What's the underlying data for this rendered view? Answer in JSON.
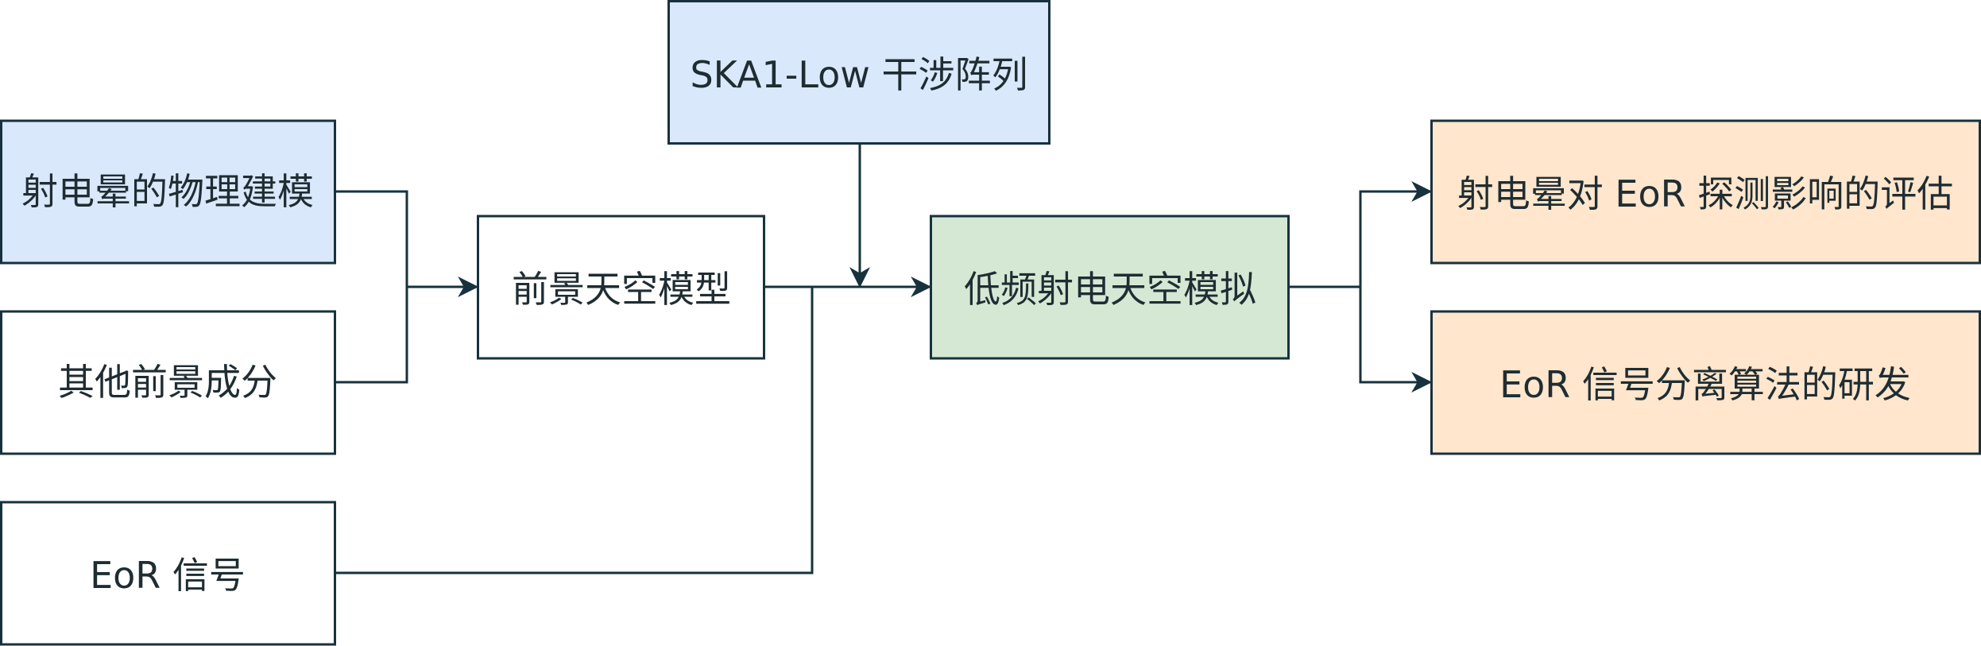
{
  "colors": {
    "blue_fill": "#dae8fc",
    "green_fill": "#d5e8d4",
    "orange_fill": "#ffe6cc",
    "white_fill": "#ffffff",
    "stroke": "#17323d",
    "text": "#1f2d33"
  },
  "nodes": {
    "radio_halo_modeling": "射电晕的物理建模",
    "other_foregrounds": "其他前景成分",
    "eor_signal": "EoR 信号",
    "foreground_sky_model": "前景天空模型",
    "ska1_low_array": "SKA1-Low 干涉阵列",
    "low_freq_sky_simulation": "低频射电天空模拟",
    "halo_impact_evaluation": "射电晕对 EoR 探测影响的评估",
    "eor_separation_algorithm": "EoR 信号分离算法的研发"
  }
}
